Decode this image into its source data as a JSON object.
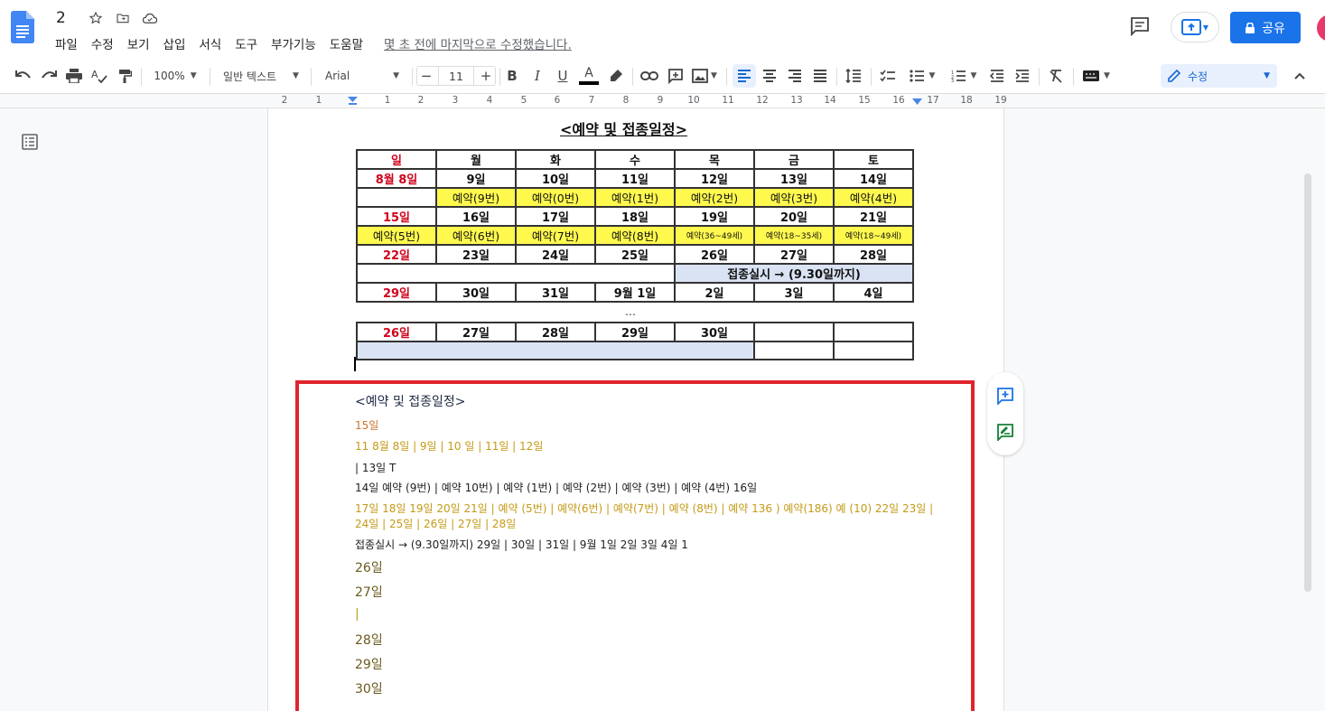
{
  "doc": {
    "title": "2",
    "saved_text": "몇 초 전에 마지막으로 수정했습니다."
  },
  "menu": [
    "파일",
    "수정",
    "보기",
    "삽입",
    "서식",
    "도구",
    "부가기능",
    "도움말"
  ],
  "header": {
    "share_label": "공유"
  },
  "toolbar": {
    "zoom": "100%",
    "style": "일반 텍스트",
    "font": "Arial",
    "font_size": "11",
    "mode": "수정"
  },
  "ruler": [
    "2",
    "1",
    "1",
    "2",
    "3",
    "4",
    "5",
    "6",
    "7",
    "8",
    "9",
    "10",
    "11",
    "12",
    "13",
    "14",
    "15",
    "16",
    "17",
    "18",
    "19"
  ],
  "image": {
    "title": "<예약 및 접종일정>",
    "header": [
      "일",
      "월",
      "화",
      "수",
      "목",
      "금",
      "토"
    ],
    "rows": [
      [
        "8월 8일",
        "9일",
        "10일",
        "11일",
        "12일",
        "13일",
        "14일"
      ],
      [
        "",
        "예약(9번)",
        "예약(0번)",
        "예약(1번)",
        "예약(2번)",
        "예약(3번)",
        "예약(4번)"
      ],
      [
        "15일",
        "16일",
        "17일",
        "18일",
        "19일",
        "20일",
        "21일"
      ],
      [
        "예약(5번)",
        "예약(6번)",
        "예약(7번)",
        "예약(8번)",
        "예약(36~49세)",
        "예약(18~35세)",
        "예약(18~49세)"
      ],
      [
        "22일",
        "23일",
        "24일",
        "25일",
        "26일",
        "27일",
        "28일"
      ],
      [
        "",
        "",
        "",
        "",
        "접종실시 → (9.30일까지)",
        "",
        ""
      ],
      [
        "29일",
        "30일",
        "31일",
        "9월 1일",
        "2일",
        "3일",
        "4일"
      ]
    ],
    "dots": "…",
    "rows2": [
      [
        "26일",
        "27일",
        "28일",
        "29일",
        "30일",
        "",
        ""
      ]
    ]
  },
  "ocr": {
    "title": "<예약 및 접종일정>",
    "lines": [
      "15일",
      "11 8월 8일 | 9일 | 10 일 | 11일 | 12일",
      "| 13일 T",
      "14일 예약 (9번) | 예약 10번) | 예약 (1번) | 예약 (2번) | 예약 (3번) | 예약 (4번) 16일",
      "17일 18일 19일 20일 21일 | 예약 (5번) | 예약(6번) | 예약(7번) | 예약 (8번) | 예약 136 ) 예약(186) 예 (10) 22일 23일 |",
      "24일 | 25일 | 26일 | 27일 | 28일",
      "접종실시 → (9.30일까지) 29일 | 30일 | 31일 | 9월 1일 2일 3일 4일 1",
      "26일",
      "27일",
      "|",
      "28일",
      "29일",
      "30일"
    ]
  },
  "colors": {
    "accent": "#1a73e8",
    "red_box": "#e0242d",
    "highlight_yellow": "#fff94e",
    "highlight_blue": "#dae3f3"
  }
}
